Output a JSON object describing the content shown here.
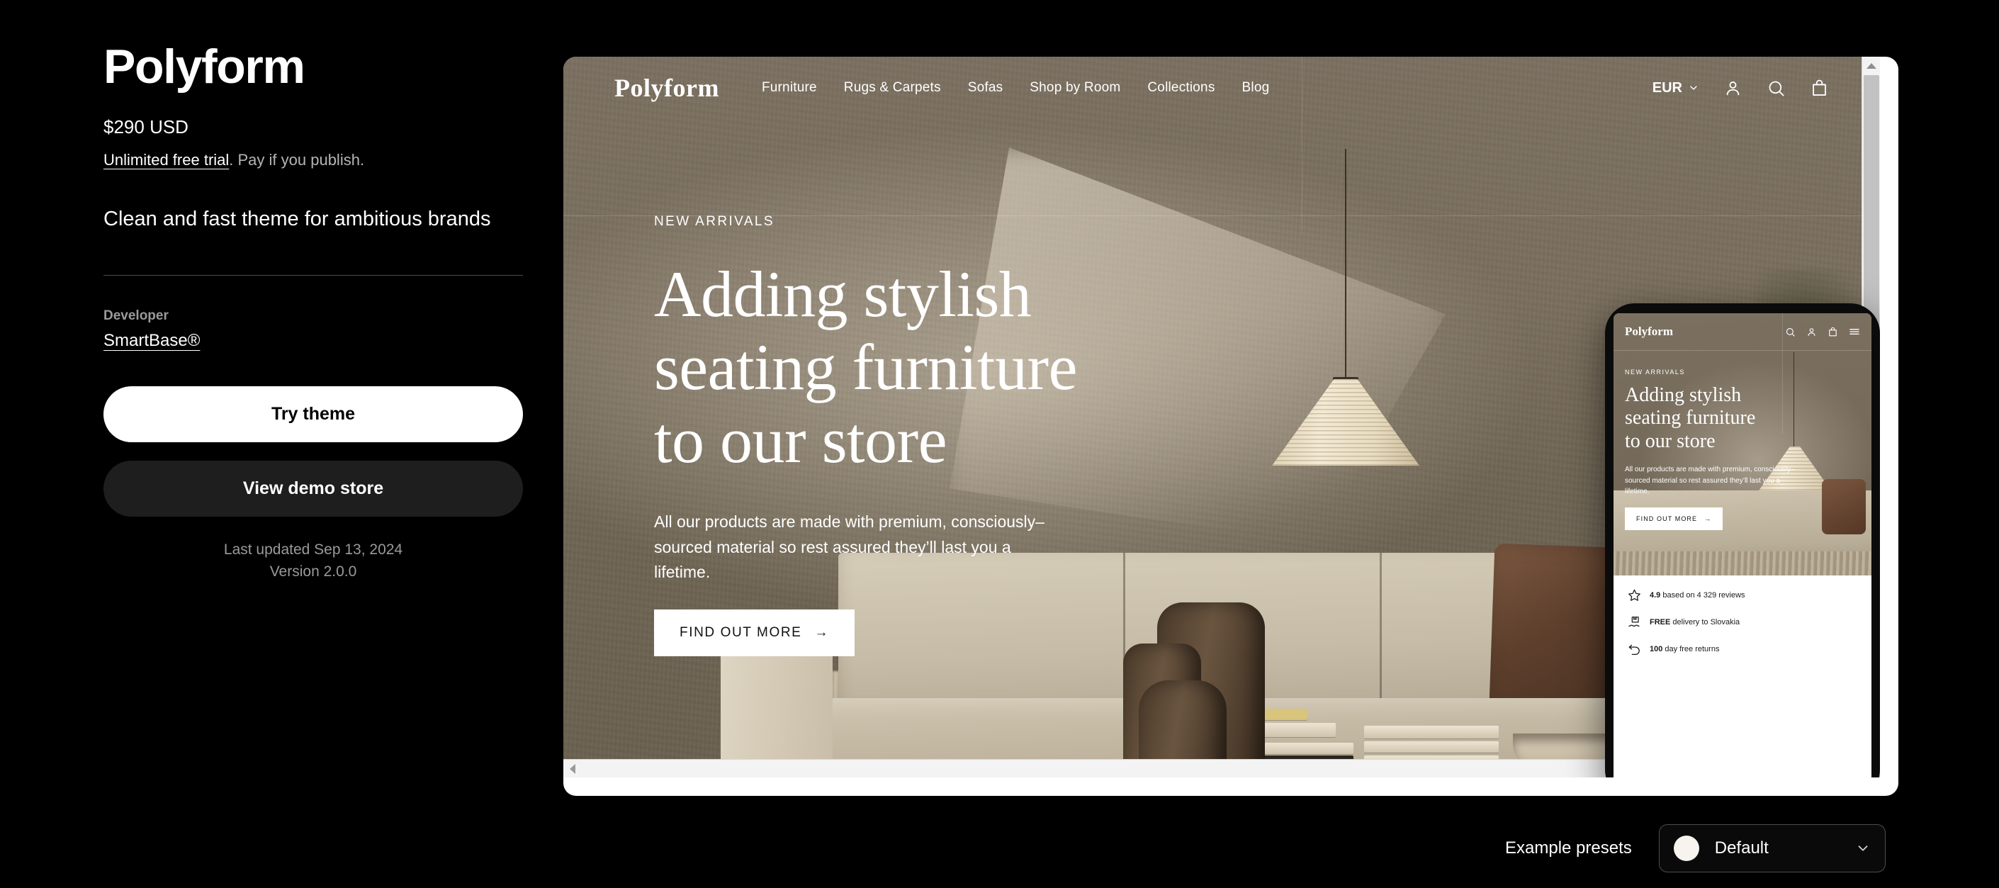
{
  "theme": {
    "title": "Polyform",
    "price": "$290 USD",
    "trial_link": "Unlimited free trial",
    "trial_rest": ". Pay if you publish.",
    "tagline": "Clean and fast theme for ambitious brands",
    "developer_label": "Developer",
    "developer_name": "SmartBase®",
    "try_button": "Try theme",
    "demo_button": "View demo store",
    "last_updated": "Last updated Sep 13, 2024",
    "version": "Version 2.0.0"
  },
  "preview": {
    "store_logo": "Polyform",
    "nav": [
      {
        "label": "Furniture"
      },
      {
        "label": "Rugs & Carpets"
      },
      {
        "label": "Sofas"
      },
      {
        "label": "Shop by Room"
      },
      {
        "label": "Collections"
      },
      {
        "label": "Blog"
      }
    ],
    "currency": "EUR",
    "icons": {
      "chevron": "chevron-down-icon",
      "account": "account-icon",
      "search": "search-icon",
      "bag": "shopping-bag-icon",
      "menu": "hamburger-menu-icon"
    },
    "hero": {
      "eyebrow": "NEW ARRIVALS",
      "title_line1": "Adding stylish",
      "title_line2": "seating furniture",
      "title_line3": "to our store",
      "subtitle": "All our products are made with premium, consciously–sourced material so rest assured they’ll last you a lifetime.",
      "cta": "FIND OUT MORE",
      "cta_arrow": "→"
    }
  },
  "mobile": {
    "store_logo": "Polyform",
    "hero": {
      "eyebrow": "NEW ARRIVALS",
      "title_line1": "Adding stylish",
      "title_line2": "seating furniture",
      "title_line3": "to our store",
      "subtitle": "All our products are made with premium, consciously–sourced material so rest assured they’ll last you a lifetime.",
      "cta": "FIND OUT MORE",
      "cta_arrow": "→"
    },
    "features": [
      {
        "icon": "star-icon",
        "bold": "4.9",
        "text": " based on 4 329 reviews"
      },
      {
        "icon": "delivery-icon",
        "bold": "FREE",
        "text": " delivery to Slovakia"
      },
      {
        "icon": "returns-icon",
        "bold": "100",
        "text": " day free returns"
      }
    ]
  },
  "presets": {
    "label": "Example presets",
    "value": "Default",
    "swatch_color": "#f7f3ee"
  },
  "colors": {
    "background": "#000000",
    "panel_card": "#1e1e1e",
    "accent_white": "#ffffff",
    "muted_text": "#9a9a9a",
    "scene_wall": "#7a6f5e"
  }
}
